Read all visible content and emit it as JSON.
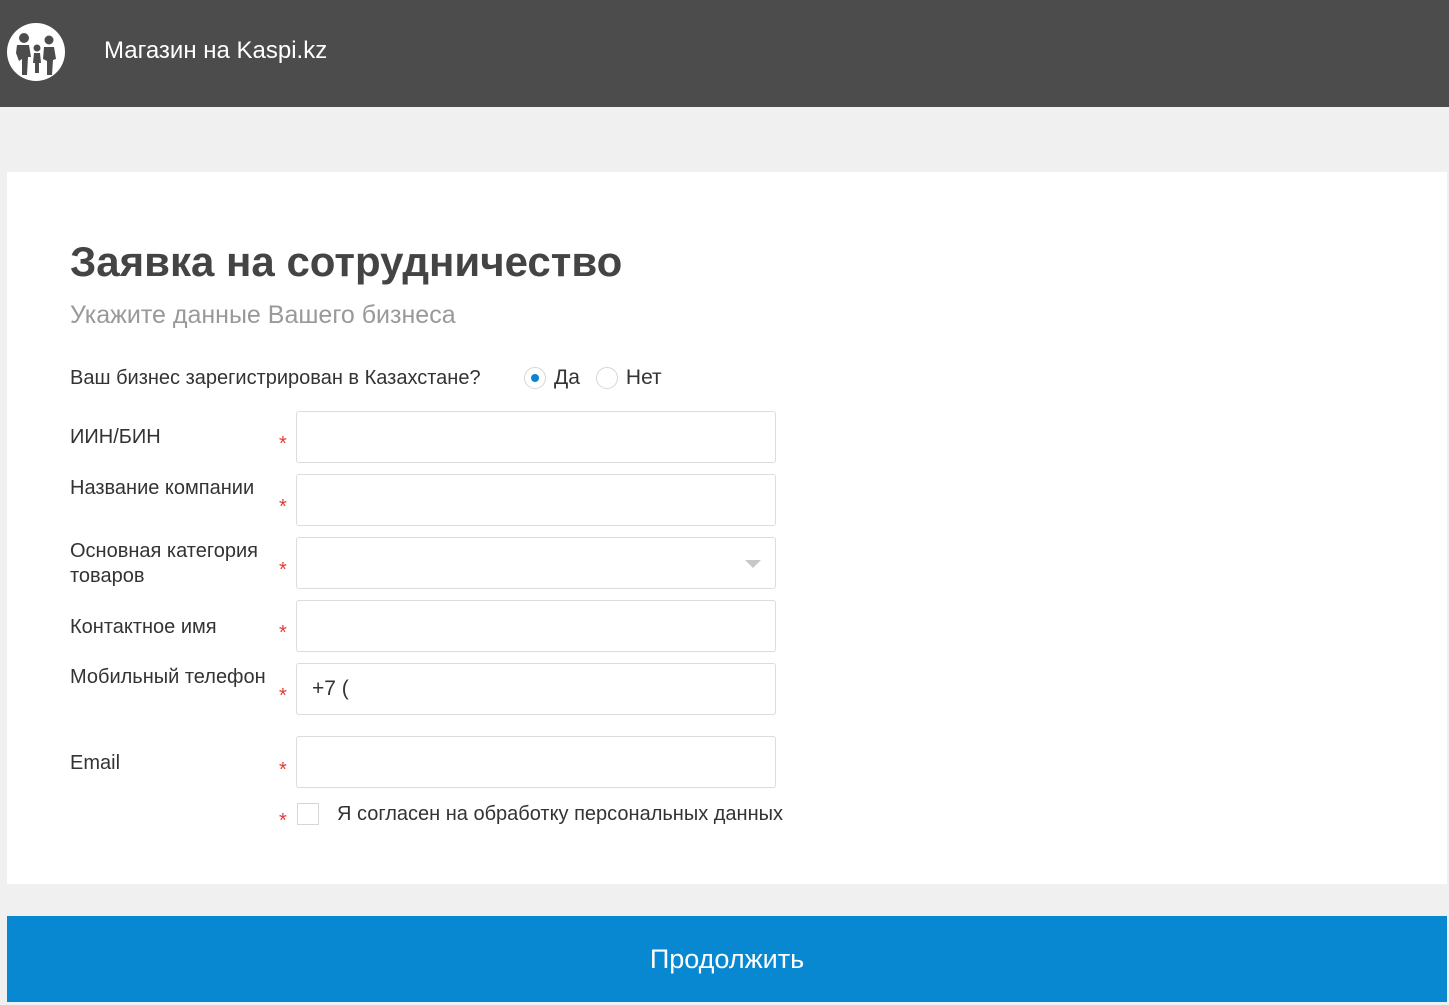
{
  "header": {
    "logo_icon": "family-logo-icon",
    "brand_text": "Магазин на Kaspi.kz"
  },
  "form": {
    "title": "Заявка на сотрудничество",
    "subtitle": "Укажите данные Вашего бизнеса",
    "registration_question": "Ваш бизнес зарегистрирован в Казахстане?",
    "registration_options": [
      {
        "label": "Да",
        "selected": true
      },
      {
        "label": "Нет",
        "selected": false
      }
    ],
    "fields": {
      "iin_bin": {
        "label": "ИИН/БИН",
        "value": ""
      },
      "company_name": {
        "label": "Название компании",
        "value": ""
      },
      "category": {
        "label": "Основная категория товаров",
        "value": ""
      },
      "contact_name": {
        "label": "Контактное имя",
        "value": ""
      },
      "phone": {
        "label": "Мобильный телефон",
        "value": "+7 ("
      },
      "email": {
        "label": "Email",
        "value": ""
      }
    },
    "required_mark": "*",
    "consent_label": "Я согласен на обработку персональных данных",
    "consent_checked": false,
    "continue_label": "Продолжить"
  },
  "colors": {
    "header_bg": "#4c4c4c",
    "accent": "#0888d1",
    "required": "#e53935",
    "page_bg": "#f0f0f0"
  }
}
